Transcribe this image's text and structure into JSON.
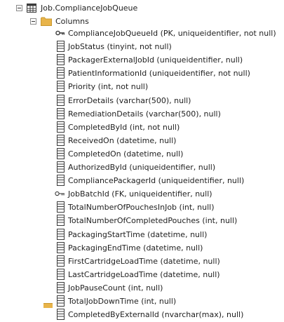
{
  "tree": {
    "table": {
      "label": "Job.ComplianceJobQueue",
      "icon": "table-icon",
      "expanded": true
    },
    "columns_folder": {
      "label": "Columns",
      "icon": "folder-icon",
      "expanded": true
    },
    "columns": [
      {
        "label": "ComplianceJobQueueId (PK, uniqueidentifier, not null)",
        "icon": "primary-key-icon"
      },
      {
        "label": "JobStatus (tinyint, not null)",
        "icon": "column-icon"
      },
      {
        "label": "PackagerExternalJobId (uniqueidentifier, null)",
        "icon": "column-icon"
      },
      {
        "label": "PatientInformationId (uniqueidentifier, not null)",
        "icon": "column-icon"
      },
      {
        "label": "Priority (int, not null)",
        "icon": "column-icon"
      },
      {
        "label": "ErrorDetails (varchar(500), null)",
        "icon": "column-icon"
      },
      {
        "label": "RemediationDetails (varchar(500), null)",
        "icon": "column-icon"
      },
      {
        "label": "CompletedById (int, not null)",
        "icon": "column-icon"
      },
      {
        "label": "ReceivedOn (datetime, null)",
        "icon": "column-icon"
      },
      {
        "label": "CompletedOn (datetime, null)",
        "icon": "column-icon"
      },
      {
        "label": "AuthorizedById (uniqueidentifier, null)",
        "icon": "column-icon"
      },
      {
        "label": "CompliancePackagerId (uniqueidentifier, null)",
        "icon": "column-icon"
      },
      {
        "label": "JobBatchId (FK, uniqueidentifier, null)",
        "icon": "foreign-key-icon"
      },
      {
        "label": "TotalNumberOfPouchesInJob (int, null)",
        "icon": "column-icon"
      },
      {
        "label": "TotalNumberOfCompletedPouches (int, null)",
        "icon": "column-icon"
      },
      {
        "label": "PackagingStartTime (datetime, null)",
        "icon": "column-icon"
      },
      {
        "label": "PackagingEndTime (datetime, null)",
        "icon": "column-icon"
      },
      {
        "label": "FirstCartridgeLoadTime (datetime, null)",
        "icon": "column-icon"
      },
      {
        "label": "LastCartridgeLoadTime (datetime, null)",
        "icon": "column-icon"
      },
      {
        "label": "JobPauseCount (int, null)",
        "icon": "column-icon"
      },
      {
        "label": "TotalJobDownTime (int, null)",
        "icon": "column-icon"
      },
      {
        "label": "CompletedByExternalId (nvarchar(max), null)",
        "icon": "column-icon"
      }
    ]
  },
  "colors": {
    "folder": "#e8b44a",
    "icon_stroke": "#3c3c3c"
  }
}
